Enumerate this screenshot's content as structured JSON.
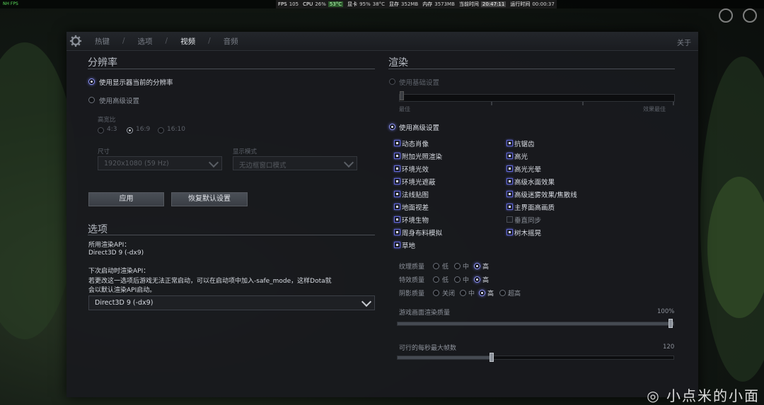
{
  "overlay": {
    "fps_corner": "NH FPS",
    "stats": [
      {
        "k": "FPS",
        "v": "105"
      },
      {
        "k": "CPU",
        "v": "26%",
        "v2": "53°C",
        "hot": true
      },
      {
        "k": "显卡",
        "v": "95%",
        "v2": "38°C"
      },
      {
        "k": "显存",
        "v": "352MB"
      },
      {
        "k": "内存",
        "v": "3573MB"
      },
      {
        "k": "当前时间",
        "v": "20:47:11",
        "hl": true
      },
      {
        "k": "运行时间",
        "v": "00:00:37"
      }
    ]
  },
  "nav": {
    "tabs": [
      "热键",
      "选项",
      "视频",
      "音频"
    ],
    "active": "视频",
    "about": "关于"
  },
  "resolution": {
    "title": "分辨率",
    "use_display": "使用显示器当前的分辨率",
    "use_advanced": "使用高级设置",
    "aspect_label": "高宽比",
    "aspects": [
      "4:3",
      "16:9",
      "16:10"
    ],
    "size_label": "尺寸",
    "size_value": "1920x1080 (59 Hz)",
    "mode_label": "显示模式",
    "mode_value": "无边框窗口模式",
    "apply": "应用",
    "restore": "恢复默认设置"
  },
  "options": {
    "title": "选项",
    "api_label": "所用渲染API：",
    "api_value": "Direct3D 9 (-dx9)",
    "next_label": "下次启动时渲染API：",
    "warning_line1": "若更改这一选项后游戏无法正常启动，可以在启动项中加入-safe_mode，这样Dota就",
    "warning_line2": "会以默认渲染API启动。",
    "select_value": "Direct3D 9 (-dx9)"
  },
  "render": {
    "title": "渲染",
    "basic": "使用基础设置",
    "slider_left": "最佳",
    "slider_right": "效果最佳",
    "advanced": "使用高级设置",
    "left_checks": [
      {
        "label": "动态肖像",
        "on": true
      },
      {
        "label": "附加光照渲染",
        "on": true
      },
      {
        "label": "环境光效",
        "on": true
      },
      {
        "label": "环境光遮蔽",
        "on": true
      },
      {
        "label": "法线贴图",
        "on": true
      },
      {
        "label": "地面视差",
        "on": true
      },
      {
        "label": "环境生物",
        "on": true
      },
      {
        "label": "周身布料模拟",
        "on": true
      },
      {
        "label": "草地",
        "on": true
      }
    ],
    "right_checks": [
      {
        "label": "抗锯齿",
        "on": true
      },
      {
        "label": "高光",
        "on": true
      },
      {
        "label": "高光光晕",
        "on": true
      },
      {
        "label": "高级水面效果",
        "on": true
      },
      {
        "label": "高级迷雾效果/焦散线",
        "on": true
      },
      {
        "label": "主界面高画质",
        "on": true
      },
      {
        "label": "垂直同步",
        "on": false
      },
      {
        "label": "树木摇晃",
        "on": true
      }
    ],
    "texture_label": "纹理质量",
    "effect_label": "特效质量",
    "shadow_label": "阴影质量",
    "low": "低",
    "mid": "中",
    "high": "高",
    "off": "关闭",
    "ultra": "超高",
    "texture_level": "高",
    "effect_level": "高",
    "shadow_level": "高",
    "render_quality_label": "游戏画面渲染质量",
    "render_quality_value": "100%",
    "render_quality_fraction": 1.0,
    "max_fps_label": "可行的每秒最大帧数",
    "max_fps_value": "120",
    "max_fps_fraction": 0.34
  },
  "watermark": "◎ 小点米的小面"
}
